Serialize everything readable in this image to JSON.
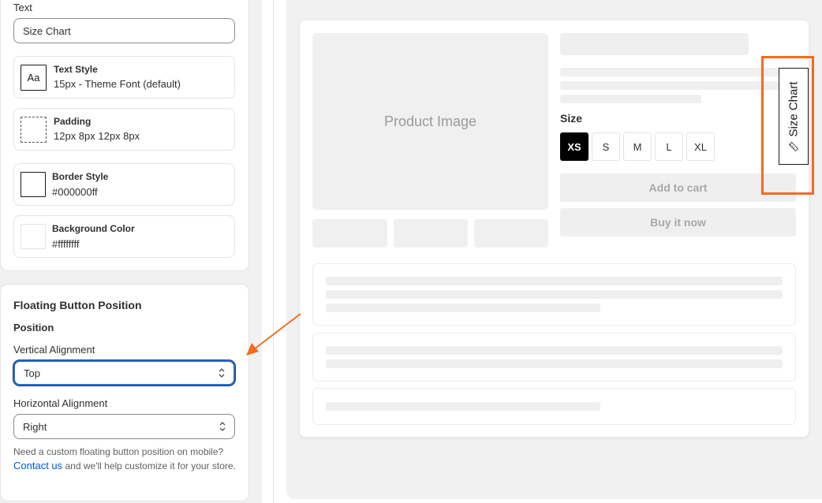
{
  "settings": {
    "text_label": "Text",
    "text_value": "Size Chart",
    "text_style": {
      "title": "Text Style",
      "value": "15px - Theme Font (default)",
      "swatch_text": "Aa"
    },
    "padding": {
      "title": "Padding",
      "value": "12px 8px 12px 8px"
    },
    "border_style": {
      "title": "Border Style",
      "value": "#000000ff"
    },
    "background_color": {
      "title": "Background Color",
      "value": "#ffffffff"
    }
  },
  "floating_position": {
    "title": "Floating Button Position",
    "position_label": "Position",
    "vertical_label": "Vertical Alignment",
    "vertical_value": "Top",
    "horizontal_label": "Horizontal Alignment",
    "horizontal_value": "Right",
    "help_prefix": "Need a custom floating button position on mobile?",
    "help_link": "Contact us",
    "help_suffix": "and we'll help customize it for your store."
  },
  "preview": {
    "product_image_label": "Product Image",
    "size_label": "Size",
    "sizes": [
      "XS",
      "S",
      "M",
      "L",
      "XL"
    ],
    "selected_size": "XS",
    "add_to_cart": "Add to cart",
    "buy_now": "Buy it now",
    "floating_button_text": "Size Chart",
    "floating_button_icon": "ruler-icon"
  },
  "colors": {
    "highlight": "#f26b21",
    "link": "#005bd3",
    "focus": "#2c6ecb"
  }
}
